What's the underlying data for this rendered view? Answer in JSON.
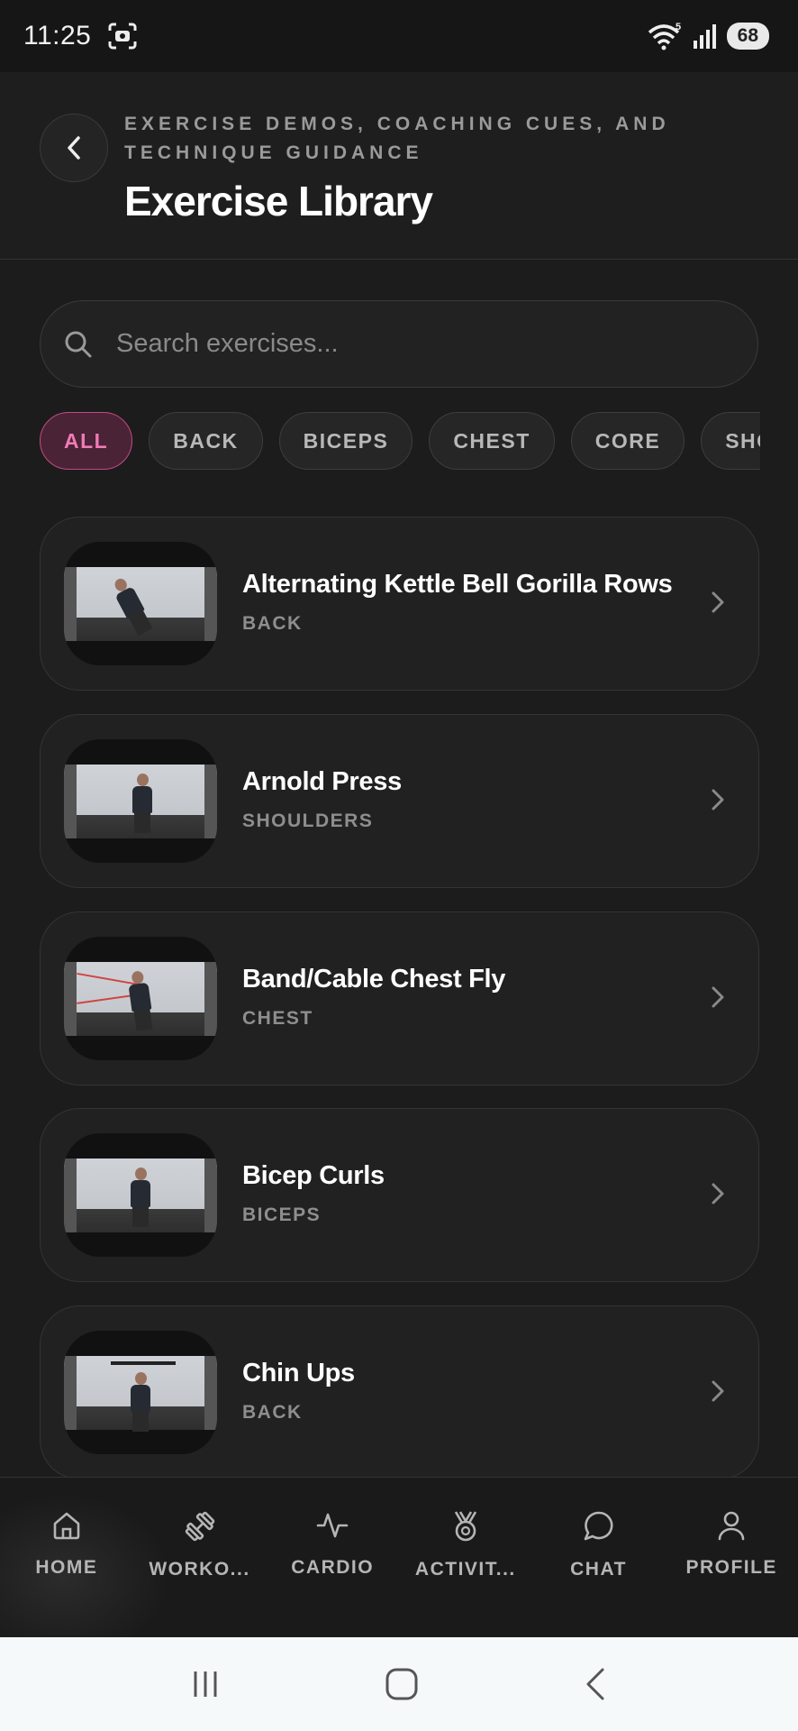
{
  "status_bar": {
    "time": "11:25",
    "battery": "68",
    "wifi_badge": "5"
  },
  "header": {
    "subtitle": "EXERCISE DEMOS, COACHING CUES, AND TECHNIQUE GUIDANCE",
    "title": "Exercise Library"
  },
  "search": {
    "placeholder": "Search exercises...",
    "value": ""
  },
  "filters": [
    "ALL",
    "BACK",
    "BICEPS",
    "CHEST",
    "CORE",
    "SHOULDERS"
  ],
  "active_filter": "ALL",
  "exercises": [
    {
      "name": "Alternating Kettle Bell Gorilla Rows",
      "category": "BACK"
    },
    {
      "name": "Arnold Press",
      "category": "SHOULDERS"
    },
    {
      "name": "Band/Cable Chest Fly",
      "category": "CHEST"
    },
    {
      "name": "Bicep Curls",
      "category": "BICEPS"
    },
    {
      "name": "Chin Ups",
      "category": "BACK"
    }
  ],
  "bottom_nav": [
    {
      "label": "HOME",
      "icon": "home-icon"
    },
    {
      "label": "WORKO...",
      "icon": "dumbbell-icon"
    },
    {
      "label": "CARDIO",
      "icon": "activity-pulse-icon"
    },
    {
      "label": "ACTIVIT...",
      "icon": "medal-icon"
    },
    {
      "label": "CHAT",
      "icon": "chat-bubble-icon"
    },
    {
      "label": "PROFILE",
      "icon": "user-icon"
    }
  ],
  "colors": {
    "background": "#1c1c1c",
    "accent": "#f07ab8",
    "accent_bg": "#4a2436"
  }
}
